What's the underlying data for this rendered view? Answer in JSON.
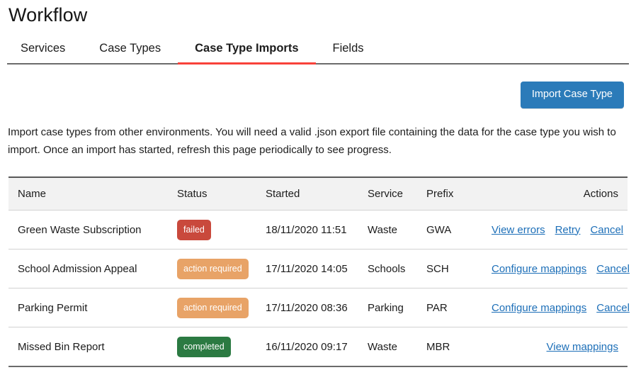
{
  "page": {
    "title": "Workflow"
  },
  "tabs": [
    {
      "label": "Services",
      "active": false
    },
    {
      "label": "Case Types",
      "active": false
    },
    {
      "label": "Case Type Imports",
      "active": true
    },
    {
      "label": "Fields",
      "active": false
    }
  ],
  "toolbar": {
    "import_button_label": "Import Case Type"
  },
  "description": "Import case types from other environments. You will need a valid .json export file containing the data for the case type you wish to import. Once an import has started, refresh this page periodically to see progress.",
  "table": {
    "columns": {
      "name": "Name",
      "status": "Status",
      "started": "Started",
      "service": "Service",
      "prefix": "Prefix",
      "actions": "Actions"
    },
    "rows": [
      {
        "name": "Green Waste Subscription",
        "status": "failed",
        "status_kind": "failed",
        "started": "18/11/2020 11:51",
        "service": "Waste",
        "prefix": "GWA",
        "actions": [
          "View errors",
          "Retry",
          "Cancel"
        ]
      },
      {
        "name": "School Admission Appeal",
        "status": "action required",
        "status_kind": "action-required",
        "started": "17/11/2020 14:05",
        "service": "Schools",
        "prefix": "SCH",
        "actions": [
          "Configure mappings",
          "Cancel"
        ]
      },
      {
        "name": "Parking Permit",
        "status": "action required",
        "status_kind": "action-required",
        "started": "17/11/2020 08:36",
        "service": "Parking",
        "prefix": "PAR",
        "actions": [
          "Configure mappings",
          "Cancel"
        ]
      },
      {
        "name": "Missed Bin Report",
        "status": "completed",
        "status_kind": "completed",
        "started": "16/11/2020 09:17",
        "service": "Waste",
        "prefix": "MBR",
        "actions": [
          "View mappings"
        ]
      }
    ]
  },
  "colors": {
    "accent_tab": "#f9423a",
    "primary_button": "#2b7bb9",
    "link": "#1d6fb8",
    "badge_failed": "#c9493c",
    "badge_action_required": "#e8a367",
    "badge_completed": "#2b7a42"
  }
}
